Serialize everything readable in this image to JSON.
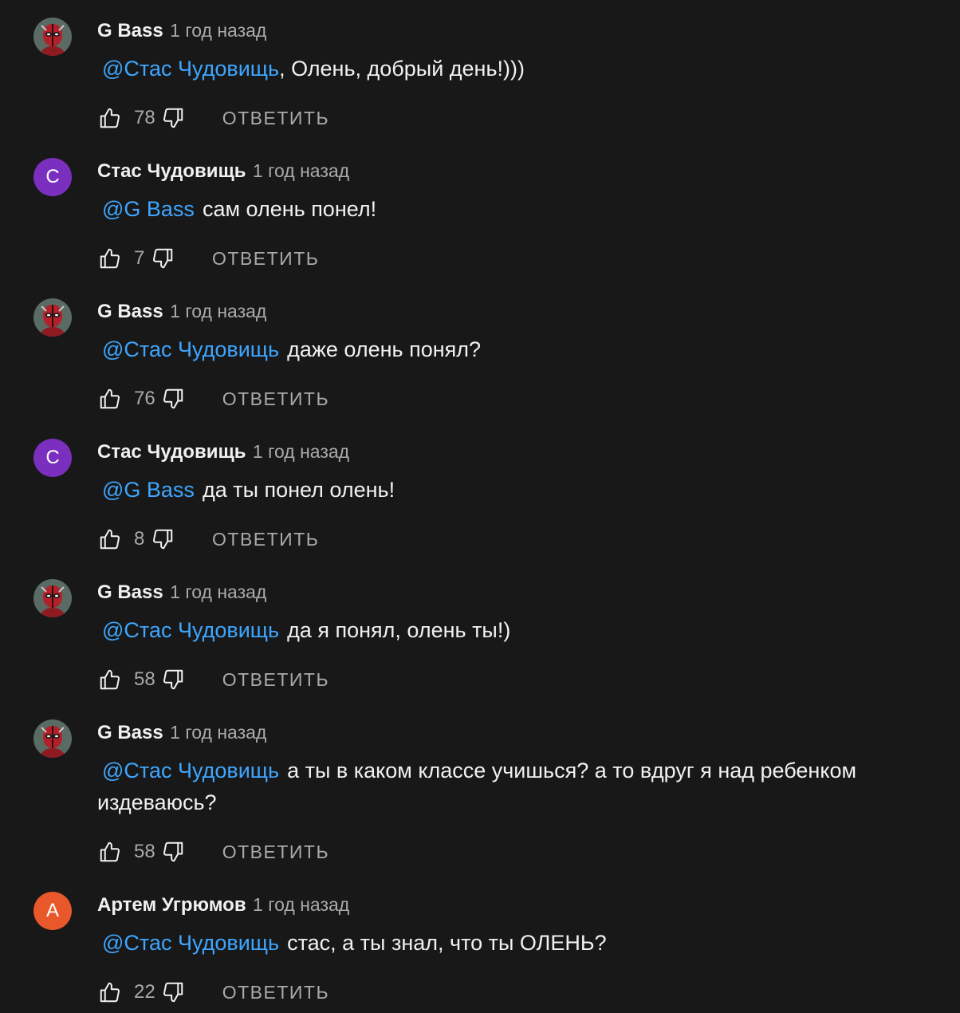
{
  "comments": [
    {
      "author": "G Bass",
      "time": "1 год назад",
      "avatar": {
        "type": "image",
        "icon": "deadpool-avatar-icon"
      },
      "mention": "@Стас Чудовищь",
      "text": ", Олень, добрый день!)))",
      "likes": "78",
      "reply_label": "ОТВЕТИТЬ"
    },
    {
      "author": "Стас Чудовищь",
      "time": "1 год назад",
      "avatar": {
        "type": "letter",
        "letter": "С",
        "color": "#7b2fbe"
      },
      "mention": "@G Bass",
      "text": "сам олень понел!",
      "likes": "7",
      "reply_label": "ОТВЕТИТЬ"
    },
    {
      "author": "G Bass",
      "time": "1 год назад",
      "avatar": {
        "type": "image",
        "icon": "deadpool-avatar-icon"
      },
      "mention": "@Стас Чудовищь",
      "text": "даже олень понял?",
      "likes": "76",
      "reply_label": "ОТВЕТИТЬ"
    },
    {
      "author": "Стас Чудовищь",
      "time": "1 год назад",
      "avatar": {
        "type": "letter",
        "letter": "С",
        "color": "#7b2fbe"
      },
      "mention": "@G Bass",
      "text": "да ты понел олень!",
      "likes": "8",
      "reply_label": "ОТВЕТИТЬ"
    },
    {
      "author": "G Bass",
      "time": "1 год назад",
      "avatar": {
        "type": "image",
        "icon": "deadpool-avatar-icon"
      },
      "mention": "@Стас Чудовищь",
      "text": "да я понял, олень ты!)",
      "likes": "58",
      "reply_label": "ОТВЕТИТЬ"
    },
    {
      "author": "G Bass",
      "time": "1 год назад",
      "avatar": {
        "type": "image",
        "icon": "deadpool-avatar-icon"
      },
      "mention": "@Стас Чудовищь",
      "text": "а ты в каком классе учишься?  а то вдруг я над ребенком издеваюсь?",
      "likes": "58",
      "reply_label": "ОТВЕТИТЬ"
    },
    {
      "author": "Артем Угрюмов",
      "time": "1 год назад",
      "avatar": {
        "type": "letter",
        "letter": "А",
        "color": "#e8582b"
      },
      "mention": "@Стас Чудовищь",
      "text": "стас, а ты знал, что ты ОЛЕНЬ?",
      "likes": "22",
      "reply_label": "ОТВЕТИТЬ"
    }
  ],
  "colors": {
    "background": "#181818",
    "mention": "#3ea6ff",
    "secondary_text": "#aaaaaa",
    "primary_text": "#f1f1f1"
  }
}
